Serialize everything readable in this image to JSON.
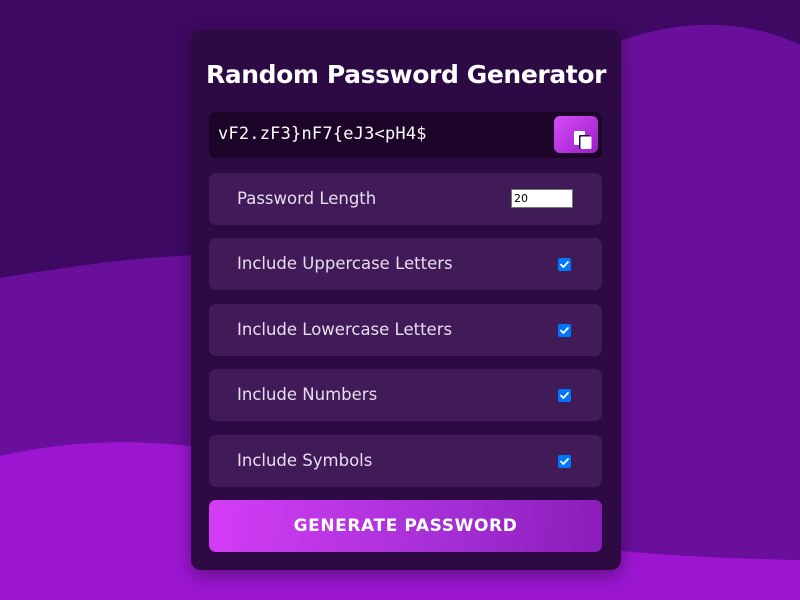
{
  "title": "Random Password Generator",
  "result": {
    "password": "vF2.zF3}nF7{eJ3<pH4$"
  },
  "options": {
    "length": {
      "label": "Password Length",
      "value": "20"
    },
    "uppercase": {
      "label": "Include Uppercase Letters",
      "checked": true
    },
    "lowercase": {
      "label": "Include Lowercase Letters",
      "checked": true
    },
    "numbers": {
      "label": "Include Numbers",
      "checked": true
    },
    "symbols": {
      "label": "Include Symbols",
      "checked": true
    }
  },
  "generate_button_label": "GENERATE PASSWORD",
  "icons": {
    "copy": "clipboard-icon",
    "check": "checkmark-icon"
  },
  "colors": {
    "background": "#6a0f9b",
    "card": "#2d0a43",
    "option_row": "#401b58",
    "result_box": "#1c0528",
    "accent_start": "#d43df6",
    "accent_end": "#8a1cb9",
    "checkbox": "#0075ff"
  }
}
